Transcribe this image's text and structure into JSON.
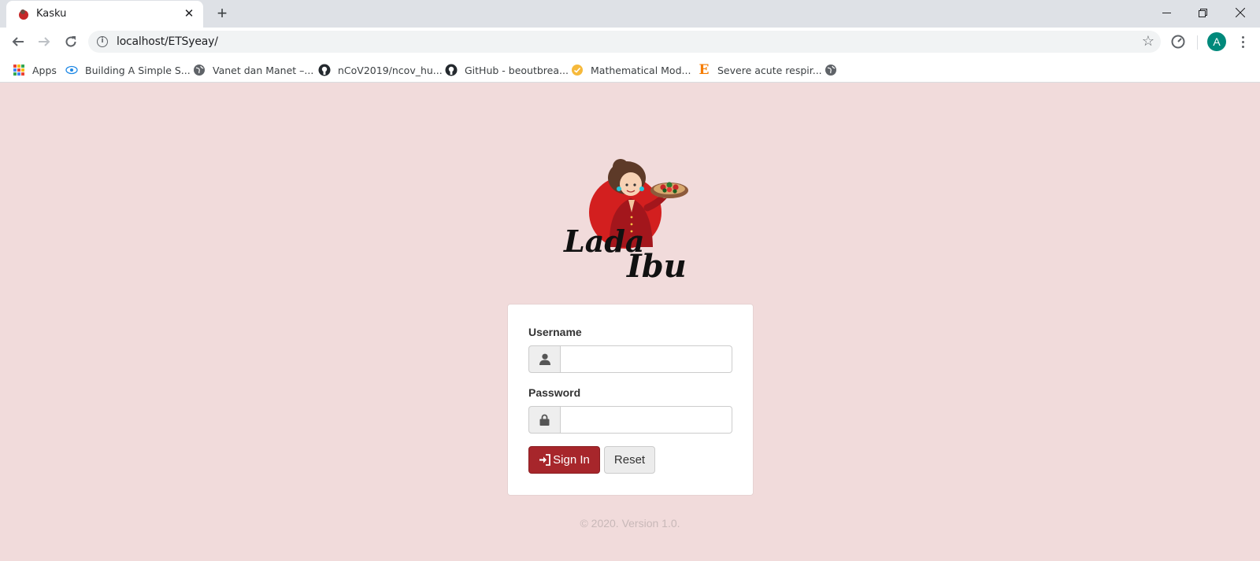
{
  "browser": {
    "tab_title": "Kasku",
    "url": "localhost/ETSyeay/",
    "avatar_letter": "A",
    "bookmarks": [
      {
        "label": "Apps",
        "icon": "apps-grid-icon"
      },
      {
        "label": "Building A Simple S...",
        "icon": "eye-icon"
      },
      {
        "label": "Vanet dan Manet –...",
        "icon": "globe-icon"
      },
      {
        "label": "nCoV2019/ncov_hu...",
        "icon": "github-icon"
      },
      {
        "label": "GitHub - beoutbrea...",
        "icon": "github-icon"
      },
      {
        "label": "Mathematical Mod...",
        "icon": "orange-circle-icon"
      },
      {
        "label": "Severe acute respir...",
        "icon": "letter-e-icon"
      },
      {
        "label": "",
        "icon": "globe-icon"
      }
    ]
  },
  "logo": {
    "text_line1": "Lada",
    "text_line2": "Ibu"
  },
  "login": {
    "username_label": "Username",
    "username_value": "",
    "password_label": "Password",
    "password_value": "",
    "signin_label": "Sign In",
    "reset_label": "Reset"
  },
  "footer": "© 2020. Version 1.0.",
  "colors": {
    "page_bg": "#f1dbdb",
    "signin_bg": "#a7262b",
    "avatar_bg": "#00897b"
  }
}
